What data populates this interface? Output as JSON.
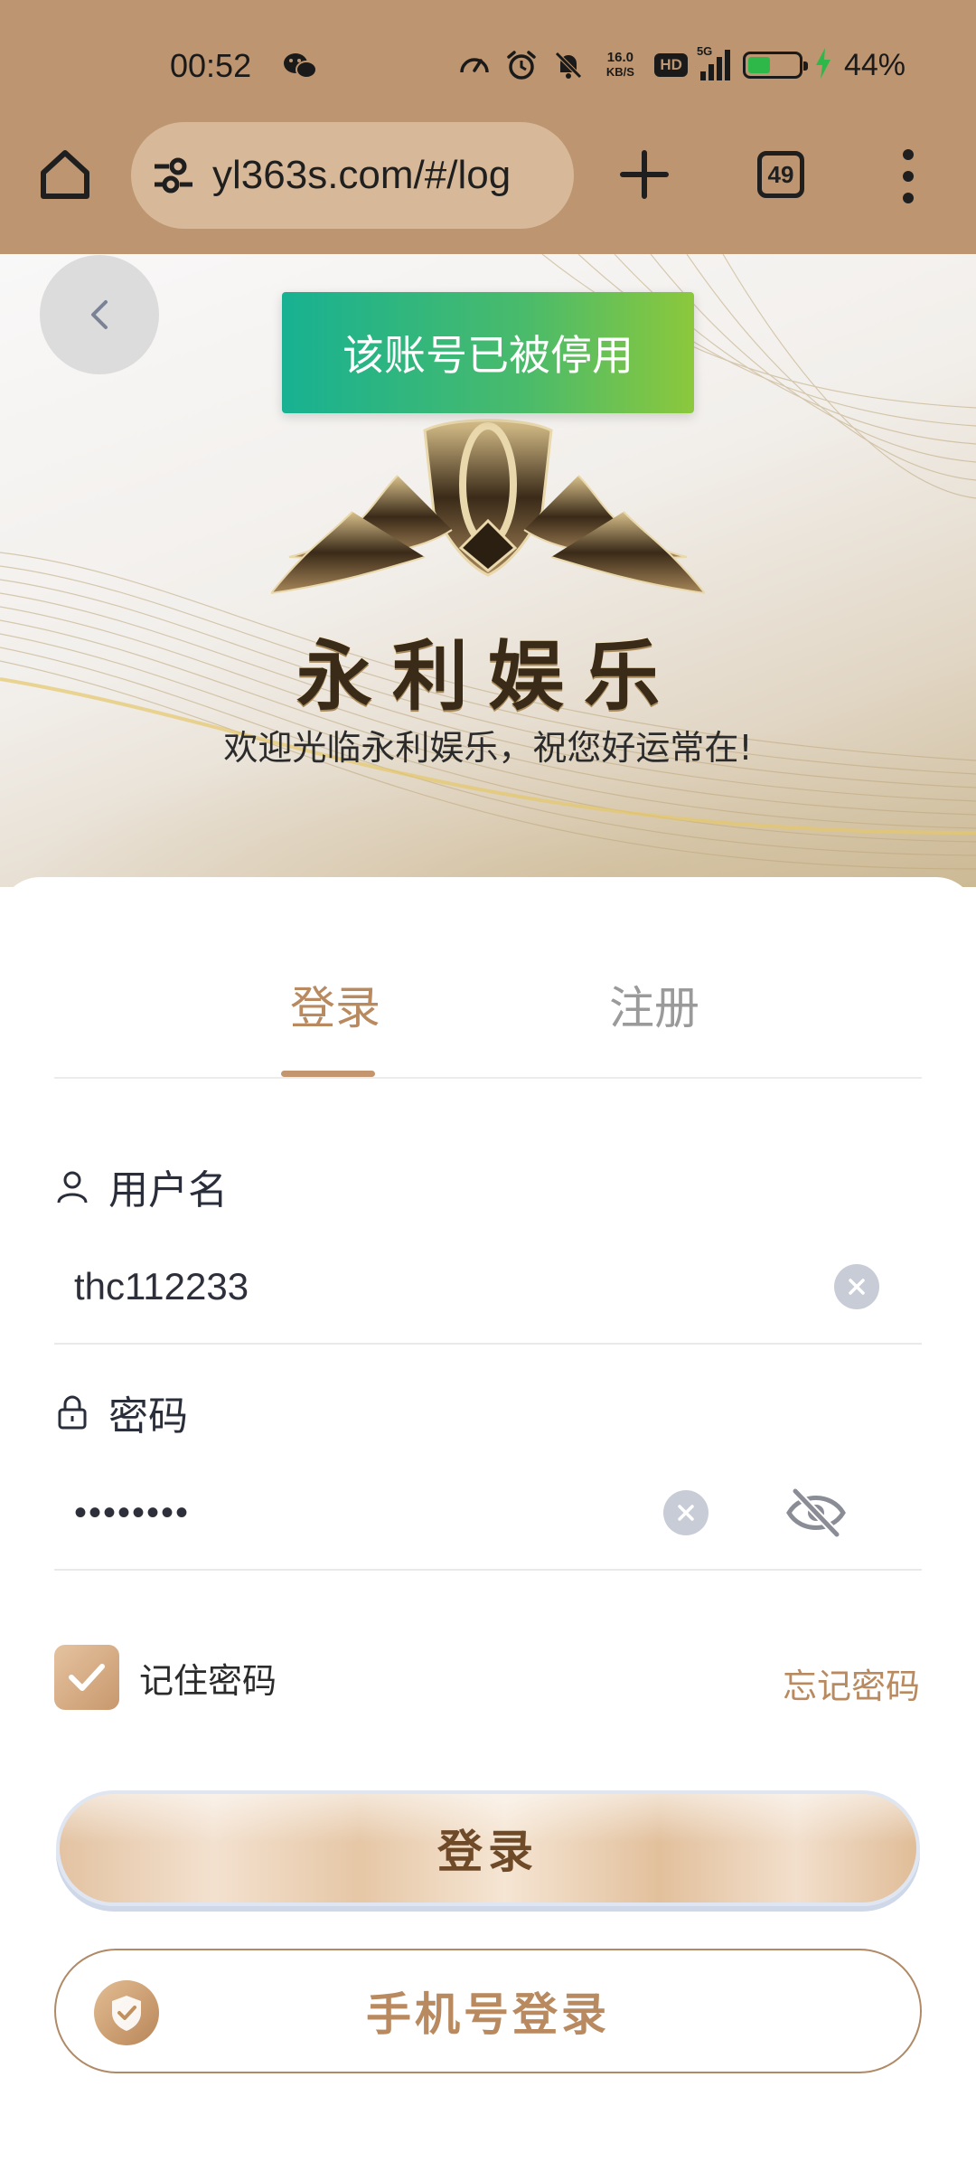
{
  "status_bar": {
    "time": "00:52",
    "net_speed_value": "16.0",
    "net_speed_unit": "KB/S",
    "hd_label": "HD",
    "signal_label": "5G",
    "battery_percent": "44%",
    "battery_level": 0.44,
    "battery_color": "#2fb84a"
  },
  "browser": {
    "url": "yl363s.com/#/log",
    "tab_count": "49"
  },
  "toast": {
    "message": "该账号已被停用"
  },
  "banner": {
    "brand": "永利娱乐",
    "welcome": "欢迎光临永利娱乐，祝您好运常在!"
  },
  "tabs": {
    "login": "登录",
    "register": "注册"
  },
  "form": {
    "username_label": "用户名",
    "username_value": "thc112233",
    "password_label": "密码",
    "password_value": "••••••••",
    "remember_label": "记住密码",
    "forgot_label": "忘记密码",
    "login_button": "登录",
    "phone_login_button": "手机号登录"
  },
  "colors": {
    "accent": "#b98a5f",
    "chrome": "#bd9671",
    "toast_start": "#17b192",
    "toast_end": "#8cc83c"
  },
  "icons": [
    "home-icon",
    "tune-icon",
    "plus-icon",
    "tabs-icon",
    "more-vert-icon",
    "back-chevron-icon",
    "user-icon",
    "lock-icon",
    "clear-icon",
    "eye-off-icon",
    "check-icon",
    "shield-check-icon"
  ]
}
